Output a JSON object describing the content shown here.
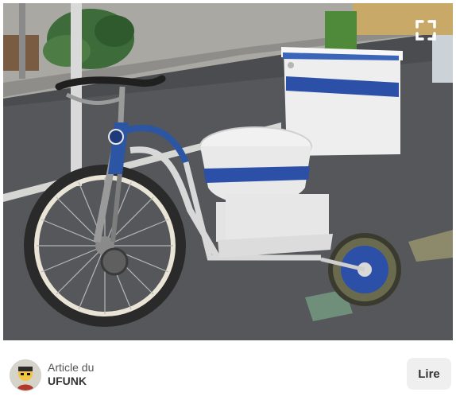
{
  "pin": {
    "image": {
      "description_icon": "photo-toilet-tricycle",
      "expand_icon": "expand-icon"
    },
    "source": {
      "label": "Article du",
      "name": "UFUNK",
      "avatar_icon": "ufunk-logo"
    },
    "action": {
      "label": "Lire"
    }
  }
}
